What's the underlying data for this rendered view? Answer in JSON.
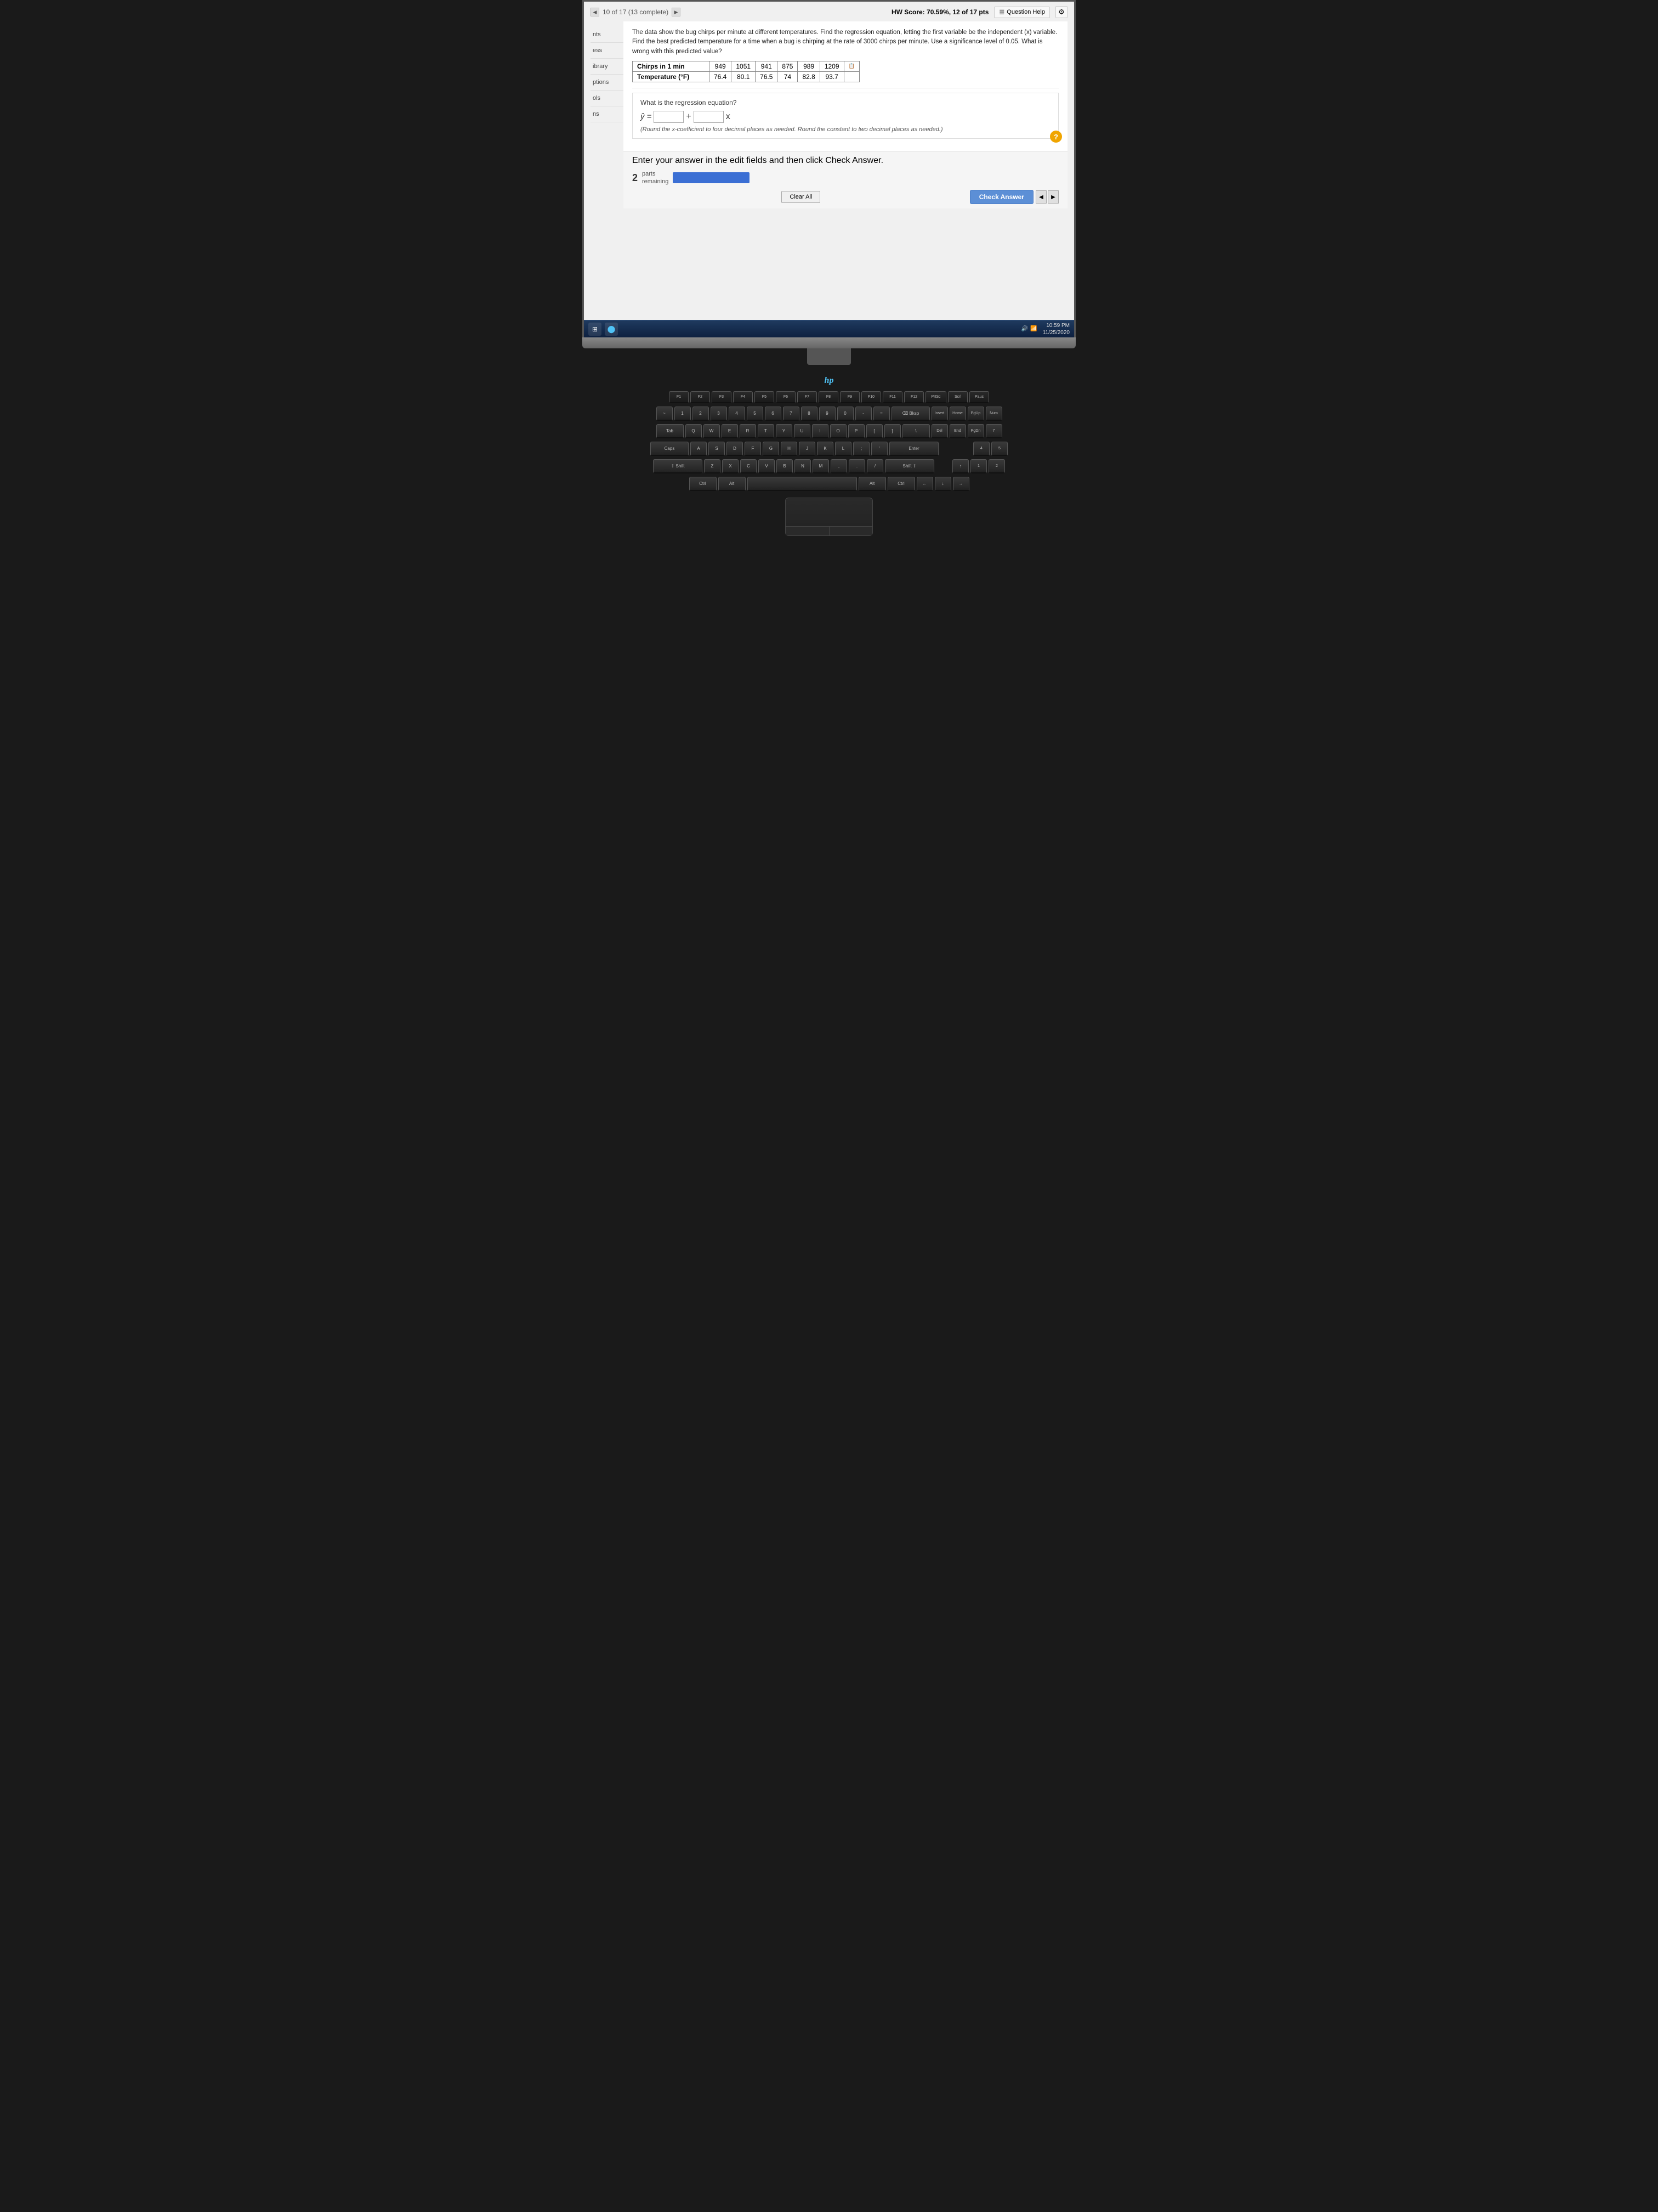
{
  "header": {
    "hw_score_label": "HW Score:",
    "hw_score_value": "70.59%, 12 of 17 pts",
    "question_help_label": "Question Help",
    "page_indicator": "10 of 17 (13 complete)"
  },
  "problem": {
    "description": "The data show the bug chirps per minute at different temperatures. Find the regression equation, letting the first variable be the independent (x) variable. Find the best predicted temperature for a time when a bug is chirping at the rate of 3000 chirps per minute. Use a significance level of 0.05. What is wrong with this predicted value?",
    "table": {
      "row1_label": "Chirps in 1 min",
      "row2_label": "Temperature (°F)",
      "row1_data": [
        "949",
        "1051",
        "941",
        "875",
        "989",
        "1209"
      ],
      "row2_data": [
        "76.4",
        "80.1",
        "76.5",
        "74",
        "82.8",
        "93.7"
      ]
    },
    "question_label": "What is the regression equation?",
    "equation_y_hat": "ŷ =",
    "plus_sign": "+",
    "x_var": "x",
    "rounding_note": "(Round the x-coefficient to four decimal places as needed. Round the constant to two decimal places as needed.)"
  },
  "answer_section": {
    "hint_text": "Enter your answer in the edit fields and then click Check Answer.",
    "parts_remaining": "2",
    "parts_label": "parts\nremaining",
    "clear_all_label": "Clear All",
    "check_answer_label": "Check Answer"
  },
  "taskbar": {
    "time": "10:59 PM",
    "date": "11/25/2020",
    "start_icon": "⊞"
  },
  "keyboard": {
    "rows": [
      [
        "F1",
        "F2",
        "F3",
        "F4",
        "F5",
        "F6",
        "F7",
        "F8",
        "F9",
        "F10",
        "F11",
        "F12"
      ],
      [
        "~",
        "1",
        "2",
        "3",
        "4",
        "5",
        "6",
        "7",
        "8",
        "9",
        "0",
        "-",
        "=",
        "⌫"
      ],
      [
        "Tab",
        "Q",
        "W",
        "E",
        "R",
        "T",
        "Y",
        "U",
        "I",
        "O",
        "P",
        "[",
        "]",
        "\\"
      ],
      [
        "Caps",
        "A",
        "S",
        "D",
        "F",
        "G",
        "H",
        "J",
        "K",
        "L",
        ";",
        "'",
        "Enter"
      ],
      [
        "Shift",
        "Z",
        "X",
        "C",
        "V",
        "B",
        "N",
        "M",
        ",",
        ".",
        "/",
        "↑Shift"
      ],
      [
        "Ctrl",
        "Alt",
        "Space",
        "Alt",
        "Ctrl",
        "←",
        "↓",
        "→"
      ]
    ],
    "brand": "hp",
    "touchpad_label": ""
  },
  "sidebar": {
    "items": [
      {
        "label": "nts"
      },
      {
        "label": "ess"
      },
      {
        "label": "ibrary"
      },
      {
        "label": "ptions"
      },
      {
        "label": "ols"
      },
      {
        "label": "ns"
      }
    ]
  }
}
